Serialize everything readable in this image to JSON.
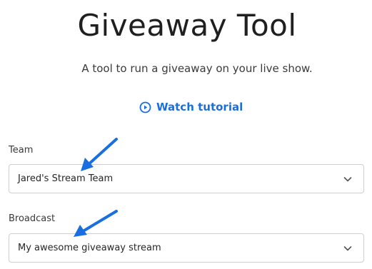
{
  "header": {
    "title": "Giveaway Tool",
    "subtitle": "A tool to run a giveaway on your live show."
  },
  "tutorial": {
    "label": "Watch tutorial",
    "icon": "play-circle-icon",
    "color": "#1a6fe0"
  },
  "fields": {
    "team": {
      "label": "Team",
      "value": "Jared's Stream Team",
      "icon": "chevron-down-icon"
    },
    "broadcast": {
      "label": "Broadcast",
      "value": "My awesome giveaway stream",
      "icon": "chevron-down-icon"
    }
  },
  "annotations": {
    "arrow_color": "#1a6fe0",
    "arrow_icon": "annotation-arrow-icon"
  }
}
